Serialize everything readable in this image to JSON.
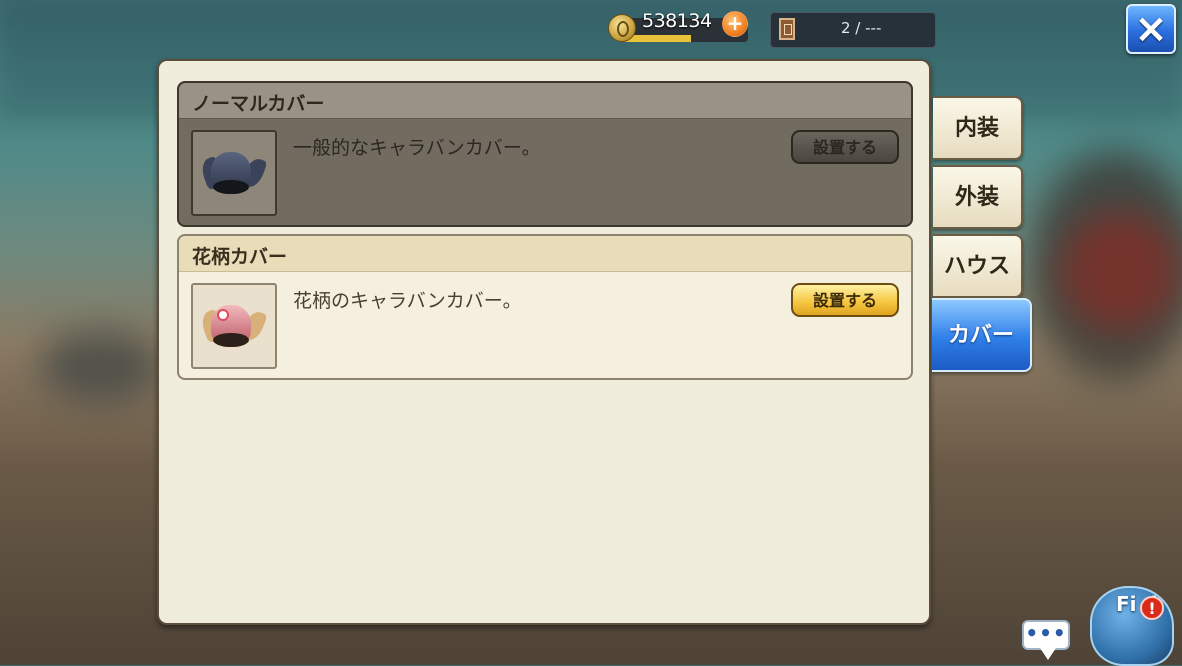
{
  "top_bar": {
    "gold_amount": "538134",
    "gold_bar_fill_percent": 55,
    "ticket_count": "2 / ---",
    "close_label": "×"
  },
  "items": [
    {
      "title": "ノーマルカバー",
      "description": "一般的なキャラバンカバー。",
      "button_label": "設置する",
      "state": "disabled",
      "icon": "dark-caravan-cover-icon"
    },
    {
      "title": "花柄カバー",
      "description": "花柄のキャラバンカバー。",
      "button_label": "設置する",
      "state": "active",
      "icon": "floral-caravan-cover-icon"
    }
  ],
  "tabs": [
    {
      "label": "内装",
      "active": false
    },
    {
      "label": "外装",
      "active": false
    },
    {
      "label": "ハウス",
      "active": false
    },
    {
      "label": "カバー",
      "active": true
    }
  ],
  "bottom": {
    "chat_label": "•••",
    "field_label": "Fi  d",
    "field_alert": "!"
  }
}
